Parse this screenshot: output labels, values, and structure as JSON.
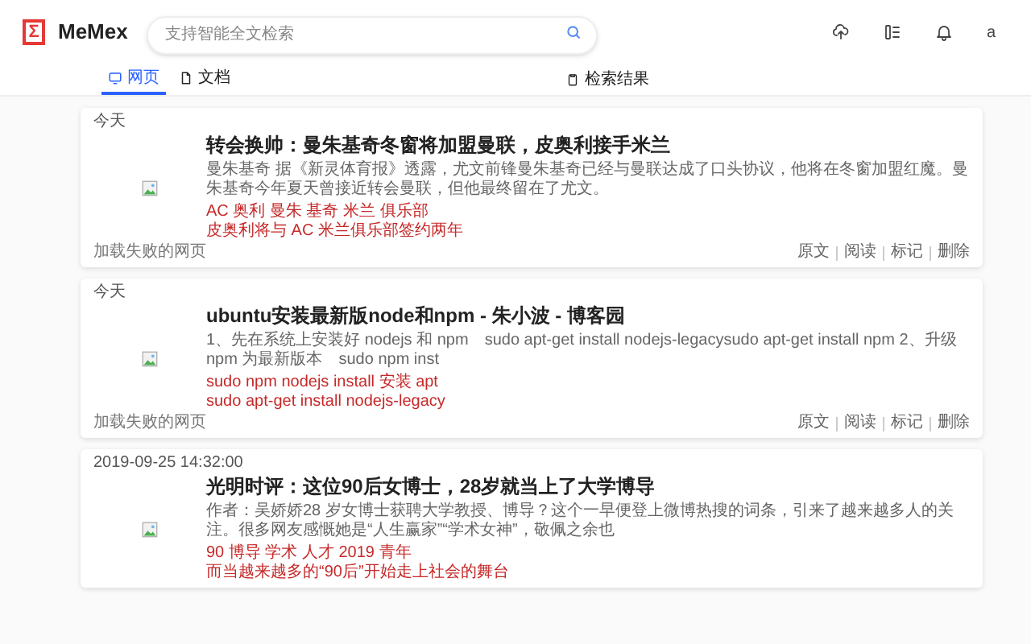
{
  "app": {
    "name": "MeMex",
    "logo": "Σ"
  },
  "search": {
    "placeholder": "支持智能全文检索"
  },
  "header_icons": [
    {
      "kind": "upload"
    },
    {
      "kind": "list"
    },
    {
      "kind": "bell"
    }
  ],
  "avatar": "a",
  "tabs": [
    {
      "label": "网页",
      "selected": true
    },
    {
      "label": "文档",
      "selected": false
    }
  ],
  "results_label": "检索结果",
  "cards": [
    {
      "date": "今天",
      "title": "转会换帅：曼朱基奇冬窗将加盟曼联，皮奥利接手米兰",
      "description": "曼朱基奇 据《新灵体育报》透露，尤文前锋曼朱基奇已经与曼联达成了口头协议，他将在冬窗加盟红魔。曼朱基奇今年夏天曾接近转会曼联，但他最终留在了尤文。",
      "tags": [
        "AC 奥利 曼朱 基奇 米兰 俱乐部",
        "皮奥利将与 AC 米兰俱乐部签约两年"
      ],
      "footer_note": "加载失败的网页",
      "actions": [
        "原文",
        "阅读",
        "标记",
        "删除"
      ]
    },
    {
      "date": "今天",
      "title": "ubuntu安装最新版node和npm - 朱小波 - 博客园",
      "description": "1、先在系统上安装好 nodejs 和 npm　sudo apt-get install nodejs-legacysudo apt-get install npm 2、升级 npm 为最新版本　sudo npm inst",
      "tags": [
        "sudo npm nodejs install 安装 apt",
        "sudo apt-get install nodejs-legacy"
      ],
      "footer_note": "加载失败的网页",
      "actions": [
        "原文",
        "阅读",
        "标记",
        "删除"
      ]
    },
    {
      "date": "2019-09-25 14:32:00",
      "title": "光明时评：这位90后女博士，28岁就当上了大学博导",
      "description": "作者：吴娇娇28 岁女博士获聘大学教授、博导？这个一早便登上微博热搜的词条，引来了越来越多人的关注。很多网友感慨她是“人生赢家”“学术女神”，敬佩之余也",
      "tags": [
        "90 博导 学术 人才 2019 青年",
        "而当越来越多的“90后”开始走上社会的舞台"
      ]
    }
  ]
}
